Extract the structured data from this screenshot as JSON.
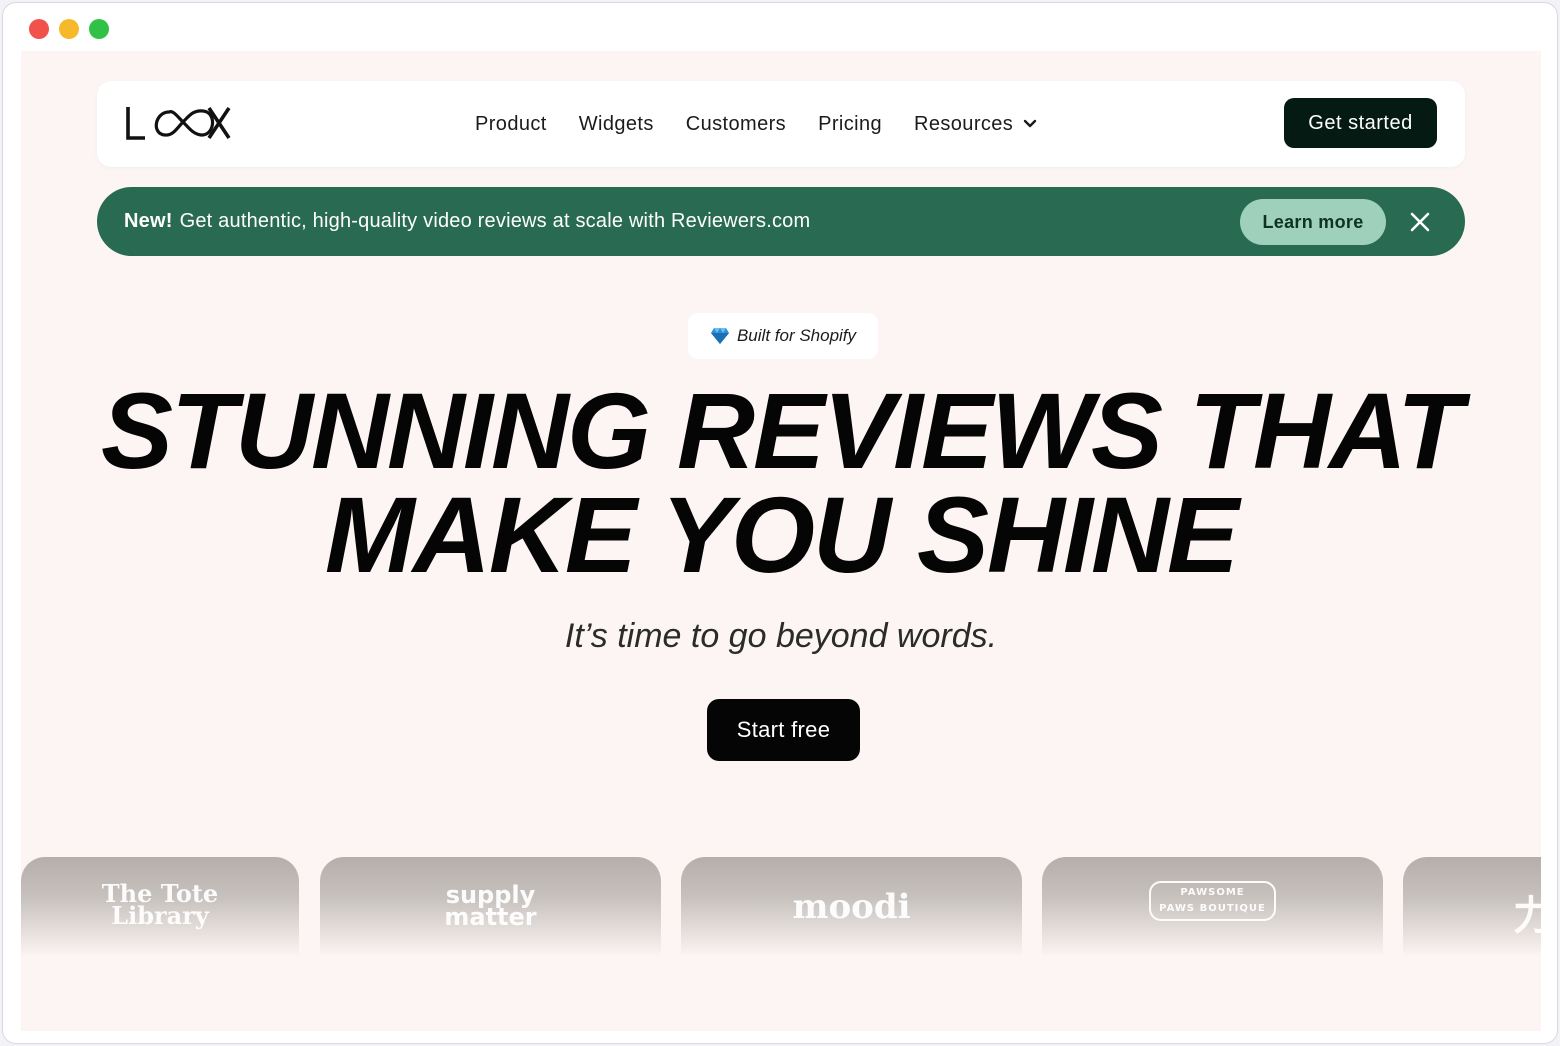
{
  "window": {
    "controls": [
      "close",
      "minimize",
      "maximize"
    ],
    "colors": {
      "close": "#f2524c",
      "minimize": "#f6b92c",
      "maximize": "#2fc246"
    }
  },
  "nav": {
    "logo": "LOOX",
    "links": [
      {
        "label": "Product"
      },
      {
        "label": "Widgets"
      },
      {
        "label": "Customers"
      },
      {
        "label": "Pricing"
      },
      {
        "label": "Resources",
        "has_dropdown": true
      }
    ],
    "cta_label": "Get started"
  },
  "banner": {
    "new_label": "New!",
    "text": "Get authentic, high-quality video reviews at scale with Reviewers.com",
    "learn_more_label": "Learn more",
    "background": "#286a52"
  },
  "hero": {
    "badge_icon": "diamond-icon",
    "badge_label": "Built for Shopify",
    "title_line1": "STUNNING REVIEWS THAT",
    "title_line2": "MAKE YOU SHINE",
    "subtitle": "It’s time to go beyond words.",
    "cta_label": "Start free"
  },
  "logos": [
    {
      "name": "The Tote Library",
      "line1": "The Tote",
      "line2": "Library"
    },
    {
      "name": "supply matter",
      "line1": "supply",
      "line2": "matter"
    },
    {
      "name": "moodi",
      "line1": "moodi",
      "line2": ""
    },
    {
      "name": "Pawsome Paws Boutique",
      "line1": "PAWSOME",
      "line2": "PAWS BOUTIQUE"
    },
    {
      "name": "力",
      "line1": "力",
      "line2": ""
    }
  ]
}
